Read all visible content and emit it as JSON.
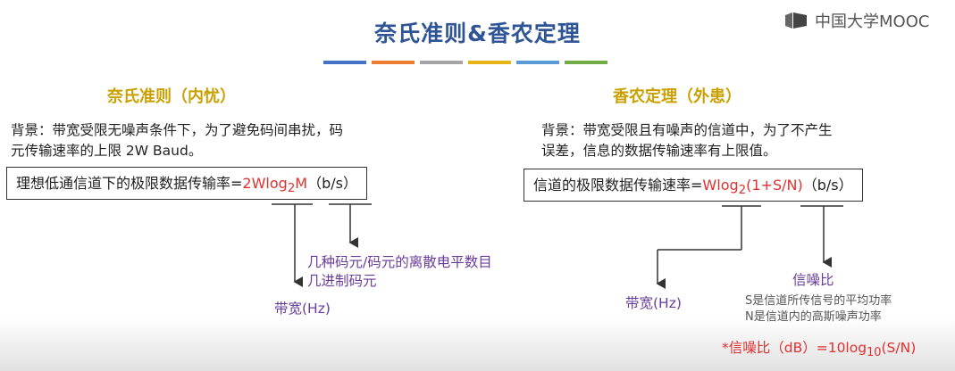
{
  "slide": {
    "title": "奈氏准则&香农定理",
    "color_bars": [
      "#4472c4",
      "#ed7d31",
      "#a5a5a5",
      "#e7b416",
      "#5b9bd5",
      "#70ad47"
    ]
  },
  "logo": {
    "text": "中国大学MOOC",
    "icon": "mooc-logo-icon"
  },
  "nyquist": {
    "heading": "奈氏准则（内忧）",
    "background_line1": "背景：带宽受限无噪声条件下，为了避免码间串扰，码",
    "background_line2": "元传输速率的上限 2W Baud。",
    "formula_prefix": "理想低通信道下的极限数据传输率=",
    "formula_main": "2Wlog",
    "formula_sub": "2",
    "formula_tail": "M",
    "formula_unit": "（b/s）",
    "label_levels_line1": "几种码元/码元的离散电平数目",
    "label_levels_line2": "几进制码元",
    "label_bandwidth": "带宽(Hz)"
  },
  "shannon": {
    "heading": "香农定理（外患）",
    "background_line1": "背景：带宽受限且有噪声的信道中，为了不产生",
    "background_line2": "误差，信息的数据传输速率有上限值。",
    "formula_prefix": "信道的极限数据传输速率=",
    "formula_main": "Wlog",
    "formula_sub": "2",
    "formula_tail": "(1+S/N)",
    "formula_unit": "（b/s）",
    "label_bandwidth": "带宽(Hz)",
    "label_snr": "信噪比",
    "snr_note_line1": "S是信道所传信号的平均功率",
    "snr_note_line2": "N是信道内的高斯噪声功率",
    "snr_db_prefix": "*信噪比（dB）=10log",
    "snr_db_sub": "10",
    "snr_db_tail": "(S/N)"
  }
}
